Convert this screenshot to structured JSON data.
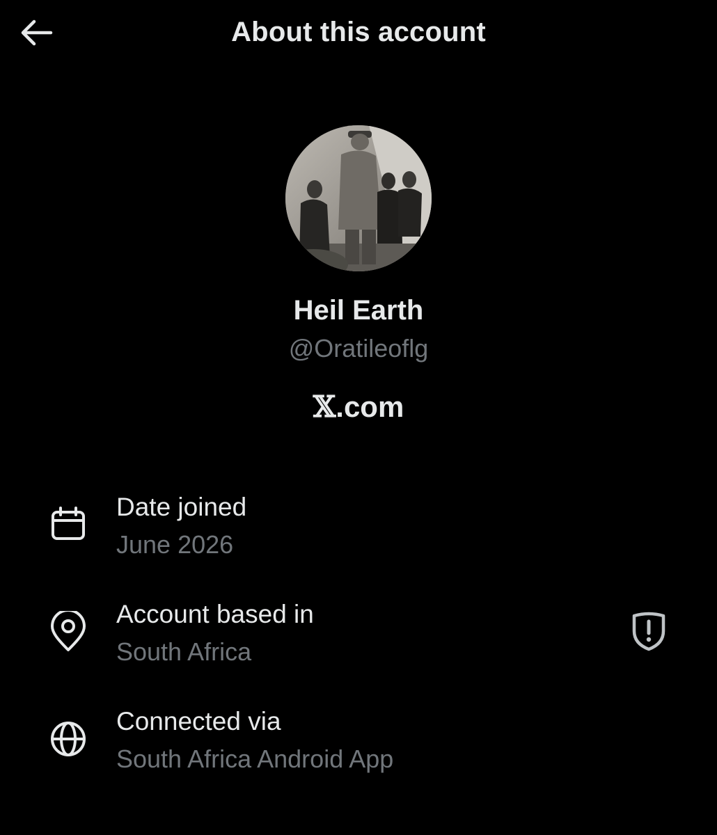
{
  "header": {
    "title": "About this account",
    "back_icon": "arrow-left-icon"
  },
  "profile": {
    "display_name": "Heil Earth",
    "handle": "@Oratileoflg",
    "platform_glyph": "𝕏",
    "platform_suffix": ".com"
  },
  "details": [
    {
      "icon": "calendar-icon",
      "label": "Date joined",
      "value": "June 2026"
    },
    {
      "icon": "location-pin-icon",
      "label": "Account based in",
      "value": "South Africa",
      "action_icon": "shield-alert-icon"
    },
    {
      "icon": "globe-icon",
      "label": "Connected via",
      "value": "South Africa Android App"
    }
  ],
  "colors": {
    "background": "#000000",
    "primary_text": "#e7e9ea",
    "secondary_text": "#71767b"
  }
}
